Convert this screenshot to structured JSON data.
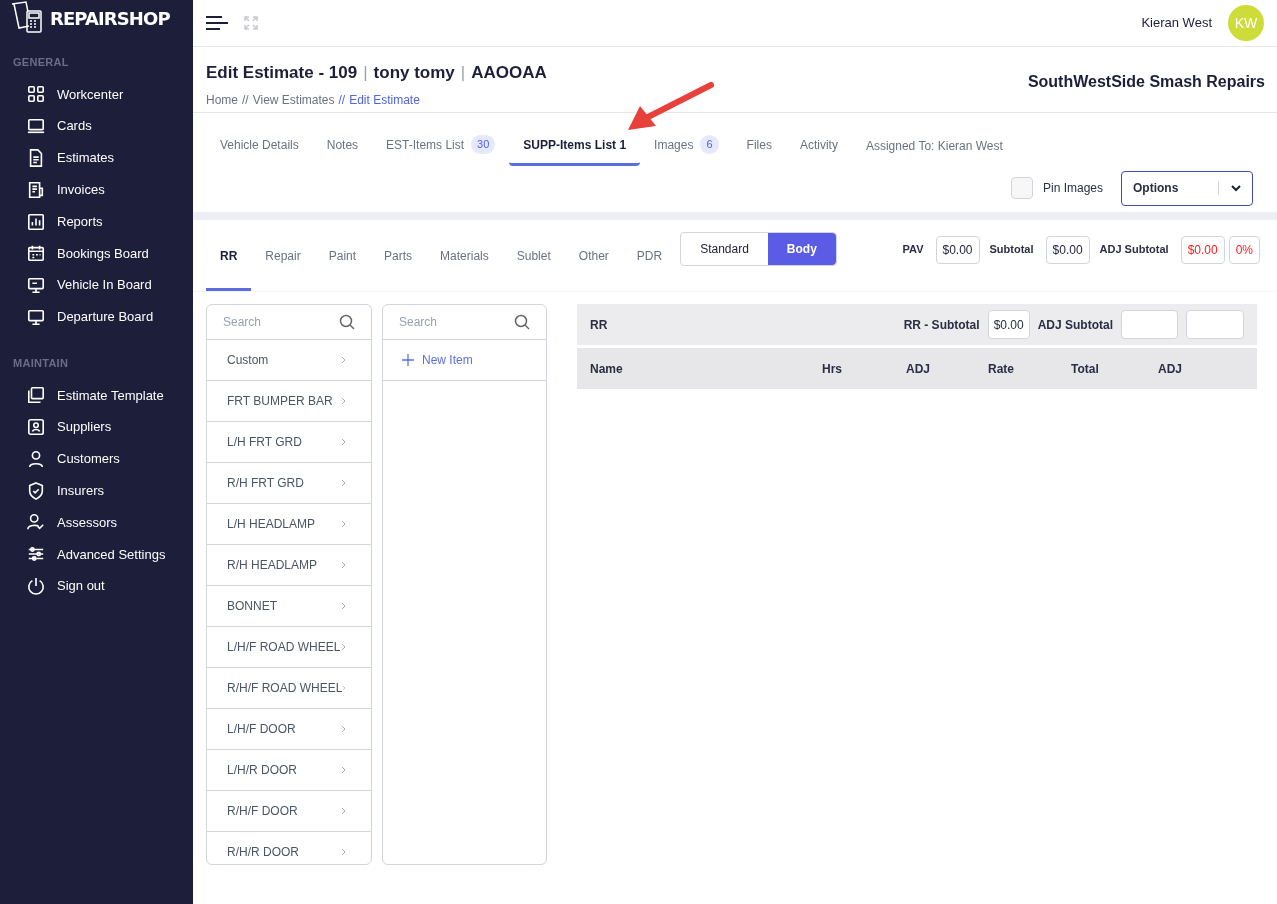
{
  "sidebar": {
    "logo": "REPAIRSHOP",
    "sections": [
      {
        "heading": "GENERAL",
        "items": [
          {
            "label": "Workcenter"
          },
          {
            "label": "Cards"
          },
          {
            "label": "Estimates"
          },
          {
            "label": "Invoices"
          },
          {
            "label": "Reports"
          },
          {
            "label": "Bookings Board"
          },
          {
            "label": "Vehicle In Board"
          },
          {
            "label": "Departure Board"
          }
        ]
      },
      {
        "heading": "MAINTAIN",
        "items": [
          {
            "label": "Estimate Template"
          },
          {
            "label": "Suppliers"
          },
          {
            "label": "Customers"
          },
          {
            "label": "Insurers"
          },
          {
            "label": "Assessors"
          },
          {
            "label": "Advanced Settings"
          },
          {
            "label": "Sign out"
          }
        ]
      }
    ]
  },
  "topbar": {
    "user_name": "Kieran West",
    "avatar_initials": "KW"
  },
  "header": {
    "title": [
      {
        "kind": "text",
        "text": "Edit Estimate - 109"
      },
      {
        "kind": "separator",
        "text": "|"
      },
      {
        "kind": "text",
        "text": "tony tomy"
      },
      {
        "kind": "separator",
        "text": "|"
      },
      {
        "kind": "text",
        "text": "AAOOAA"
      }
    ],
    "breadcrumbs": [
      {
        "label": "Home",
        "selected": false
      },
      {
        "separator": "//",
        "label": "View Estimates",
        "selected": false
      },
      {
        "separator": "//",
        "label": "Edit Estimate",
        "selected": true
      }
    ],
    "company": "SouthWestSide Smash Repairs"
  },
  "tabs": [
    {
      "label": "Vehicle Details",
      "selected": false
    },
    {
      "label": "Notes",
      "selected": false
    },
    {
      "label": "EST-Items List",
      "badge": "30",
      "selected": false
    },
    {
      "label": "SUPP-Items List 1",
      "selected": true
    },
    {
      "label": "Images",
      "badge": "6",
      "selected": false
    },
    {
      "label": "Files",
      "selected": false
    },
    {
      "label": "Activity",
      "selected": false
    }
  ],
  "assigned": "Assigned To: Kieran West",
  "pin_images": {
    "label": "Pin Images",
    "checked": false
  },
  "options": {
    "label": "Options"
  },
  "category_tabs": [
    {
      "label": "RR",
      "selected": true
    },
    {
      "label": "Repair",
      "selected": false
    },
    {
      "label": "Paint",
      "selected": false
    },
    {
      "label": "Parts",
      "selected": false
    },
    {
      "label": "Materials",
      "selected": false
    },
    {
      "label": "Sublet",
      "selected": false
    },
    {
      "label": "Other",
      "selected": false
    },
    {
      "label": "PDR",
      "selected": false
    }
  ],
  "mode_toggle": [
    {
      "label": "Standard",
      "selected": false
    },
    {
      "label": "Body",
      "selected": true
    }
  ],
  "totals": [
    {
      "label": "PAV",
      "values": [
        {
          "text": "$0.00",
          "kind": "normal"
        }
      ]
    },
    {
      "label": "Subtotal",
      "values": [
        {
          "text": "$0.00",
          "kind": "normal"
        }
      ]
    },
    {
      "label": "ADJ Subtotal",
      "values": [
        {
          "text": "$0.00",
          "kind": "alert"
        },
        {
          "text": "0%",
          "kind": "alert"
        }
      ]
    }
  ],
  "parts_list": {
    "placeholder": "Search",
    "items": [
      "Custom",
      "FRT BUMPER BAR",
      "L/H FRT GRD",
      "R/H FRT GRD",
      "L/H HEADLAMP",
      "R/H HEADLAMP",
      "BONNET",
      "L/H/F ROAD WHEEL",
      "R/H/F ROAD WHEEL",
      "L/H/F DOOR",
      "L/H/R DOOR",
      "R/H/F DOOR",
      "R/H/R DOOR"
    ]
  },
  "items_list": {
    "placeholder": "Search",
    "new_item": "New Item"
  },
  "table": {
    "title": "RR",
    "subtotal_label": "RR - Subtotal",
    "subtotal": "$0.00",
    "adj_label": "ADJ Subtotal",
    "columns": [
      "Name",
      "Hrs",
      "ADJ",
      "Rate",
      "Total",
      "ADJ"
    ]
  }
}
